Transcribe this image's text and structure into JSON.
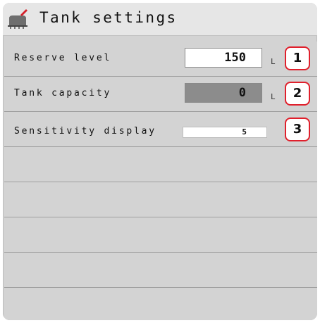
{
  "window": {
    "title": "Tank settings",
    "title_icon": "sprayer-tank-icon"
  },
  "settings": [
    {
      "label": "Reserve level",
      "value": "150",
      "unit": "L",
      "callout": "1",
      "state": "editable"
    },
    {
      "label": "Tank capacity",
      "value": "0",
      "unit": "L",
      "callout": "2",
      "state": "read-only"
    },
    {
      "label": "Sensitivity display",
      "value": "5",
      "callout": "3",
      "state": "slider"
    }
  ],
  "colors": {
    "background": "#d3d3d3",
    "callout_border": "#e0202c",
    "readonly_field": "#8c8c8c"
  }
}
